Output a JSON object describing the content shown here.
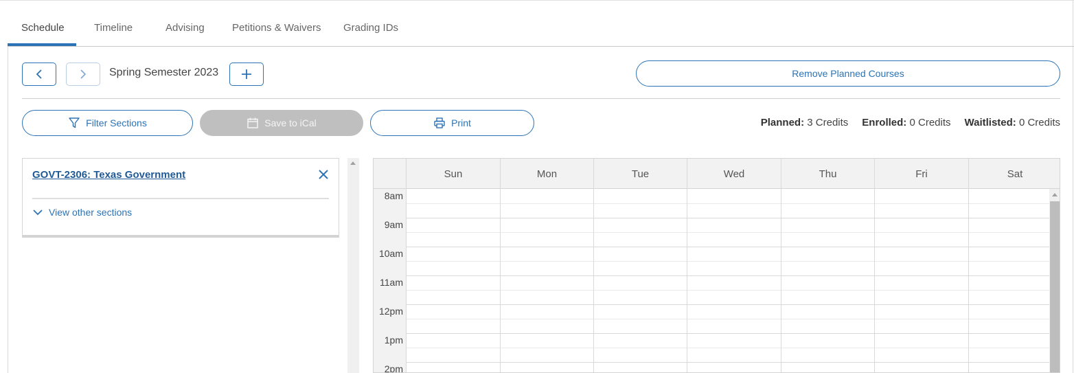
{
  "tabs": [
    {
      "label": "Schedule",
      "active": true
    },
    {
      "label": "Timeline",
      "active": false
    },
    {
      "label": "Advising",
      "active": false
    },
    {
      "label": "Petitions & Waivers",
      "active": false
    },
    {
      "label": "Grading IDs",
      "active": false
    }
  ],
  "term": {
    "label": "Spring Semester 2023",
    "prev_icon": "chevron-left-icon",
    "next_icon": "chevron-right-icon",
    "add_icon": "plus-icon"
  },
  "actions": {
    "remove_planned": "Remove Planned Courses",
    "filter_sections": "Filter Sections",
    "save_ical": "Save to iCal",
    "print": "Print"
  },
  "credits": {
    "planned_label": "Planned:",
    "planned_value": "3 Credits",
    "enrolled_label": "Enrolled:",
    "enrolled_value": "0 Credits",
    "waitlisted_label": "Waitlisted:",
    "waitlisted_value": "0 Credits"
  },
  "course": {
    "title": "GOVT-2306: Texas Government",
    "view_other": "View other sections"
  },
  "calendar": {
    "days": [
      "Sun",
      "Mon",
      "Tue",
      "Wed",
      "Thu",
      "Fri",
      "Sat"
    ],
    "times": [
      "8am",
      "9am",
      "10am",
      "11am",
      "12pm",
      "1pm",
      "2pm"
    ]
  },
  "colors": {
    "accent": "#2b73b6",
    "link": "#1f5a96",
    "disabled_button": "#bfbfbf"
  }
}
